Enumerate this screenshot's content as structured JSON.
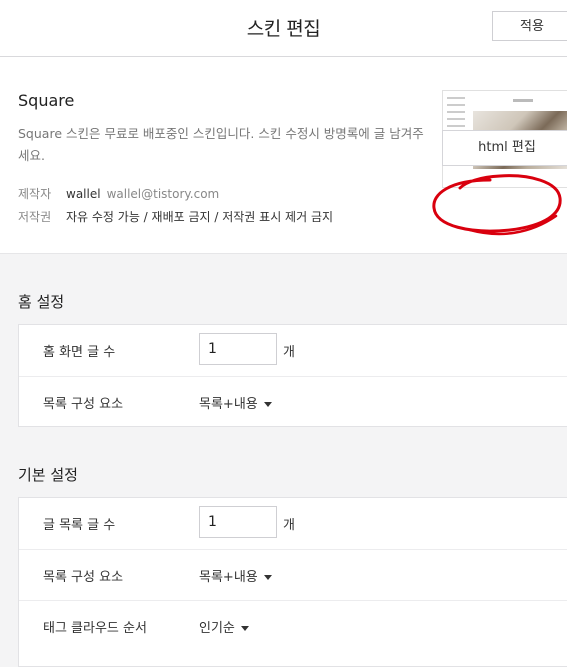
{
  "header": {
    "title": "스킨 편집",
    "apply_label": "적용"
  },
  "skin": {
    "name": "Square",
    "description": "Square 스킨은 무료로 배포중인 스킨입니다. 스킨 수정시 방명록에 글 남겨주세요.",
    "author_label": "제작자",
    "author_name": "wallel",
    "author_email": "wallel@tistory.com",
    "copyright_label": "저작권",
    "copyright_value": "자유 수정 가능 / 재배포 금지 / 저작권 표시 제거 금지",
    "html_edit_label": "html 편집"
  },
  "home_settings": {
    "title": "홈 설정",
    "rows": [
      {
        "label": "홈 화면 글 수",
        "value": "1",
        "unit": "개"
      },
      {
        "label": "목록 구성 요소",
        "value": "목록+내용"
      }
    ]
  },
  "basic_settings": {
    "title": "기본 설정",
    "rows": [
      {
        "label": "글 목록 글 수",
        "value": "1",
        "unit": "개"
      },
      {
        "label": "목록 구성 요소",
        "value": "목록+내용"
      },
      {
        "label": "태그 클라우드 순서",
        "value": "인기순"
      }
    ]
  },
  "colors": {
    "annotation_circle": "#d9000e",
    "accent": "#333333"
  }
}
